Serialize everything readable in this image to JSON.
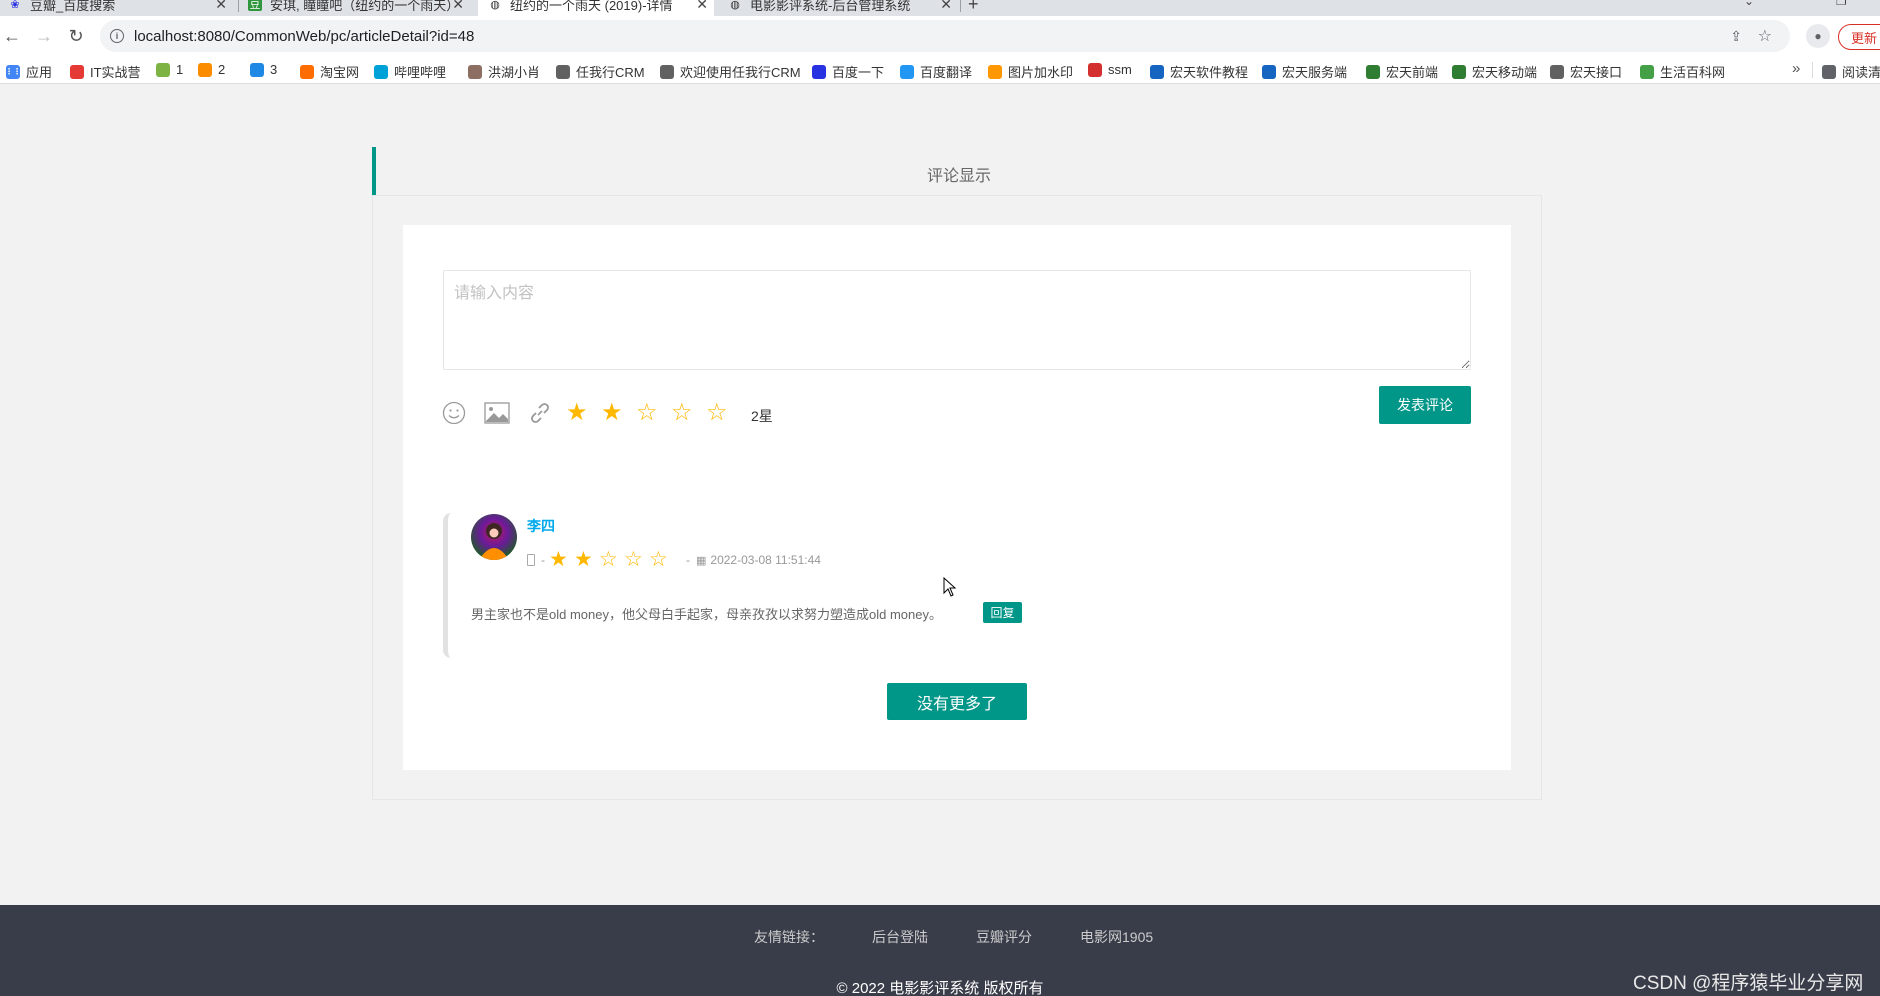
{
  "browser": {
    "tabs": [
      {
        "title": "豆瓣_百度搜索"
      },
      {
        "title": "安琪, 瞳瞳吧（纽约的一个雨天）"
      },
      {
        "title": "纽约的一个雨天 (2019)-详情"
      },
      {
        "title": "电影影评系统-后台管理系统"
      }
    ],
    "url": "localhost:8080/CommonWeb/pc/articleDetail?id=48",
    "update_label": "更新"
  },
  "bookmarks": [
    {
      "label": "应用",
      "color": "#4285f4"
    },
    {
      "label": "IT实战营",
      "color": "#e53935"
    },
    {
      "label": "1",
      "color": "#7cb342"
    },
    {
      "label": "2",
      "color": "#fb8c00"
    },
    {
      "label": "3",
      "color": "#1e88e5"
    },
    {
      "label": "淘宝网",
      "color": "#ff6d00"
    },
    {
      "label": "哔哩哔哩",
      "color": "#00a1d6"
    },
    {
      "label": "洪湖小肖",
      "color": "#8d6e63"
    },
    {
      "label": "任我行CRM",
      "color": "#616161"
    },
    {
      "label": "欢迎使用任我行CRM",
      "color": "#616161"
    },
    {
      "label": "百度一下",
      "color": "#2932e1"
    },
    {
      "label": "百度翻译",
      "color": "#2196f3"
    },
    {
      "label": "图片加水印",
      "color": "#ff9800"
    },
    {
      "label": "ssm",
      "color": "#d32f2f"
    },
    {
      "label": "宏天软件教程",
      "color": "#1565c0"
    },
    {
      "label": "宏天服务端",
      "color": "#1565c0"
    },
    {
      "label": "宏天前端",
      "color": "#2e7d32"
    },
    {
      "label": "宏天移动端",
      "color": "#2e7d32"
    },
    {
      "label": "宏天接口",
      "color": "#616161"
    },
    {
      "label": "生活百科网",
      "color": "#43a047"
    }
  ],
  "bookmarks_extra": "阅读清",
  "section": {
    "title": "评论显示"
  },
  "editor": {
    "placeholder": "请输入内容",
    "rating": 2,
    "rating_max": 5,
    "rating_text": "2星",
    "submit_label": "发表评论"
  },
  "comments": [
    {
      "user": "李四",
      "rating": 2,
      "sep1": "-",
      "sep2": "-",
      "time": "2022-03-08 11:51:44",
      "text": "男主家也不是old money，他父母白手起家，母亲孜孜以求努力塑造成old money。",
      "reply_label": "回复"
    }
  ],
  "no_more_label": "没有更多了",
  "footer": {
    "links_title": "友情链接：",
    "links": [
      "后台登陆",
      "豆瓣评分",
      "电影网1905"
    ],
    "copyright": "© 2022 电影影评系统 版权所有",
    "watermark": "CSDN @程序猿毕业分享网"
  },
  "colors": {
    "accent": "#009688",
    "star": "#ffb800",
    "username": "#01aaed",
    "footer_bg": "#393d49"
  }
}
